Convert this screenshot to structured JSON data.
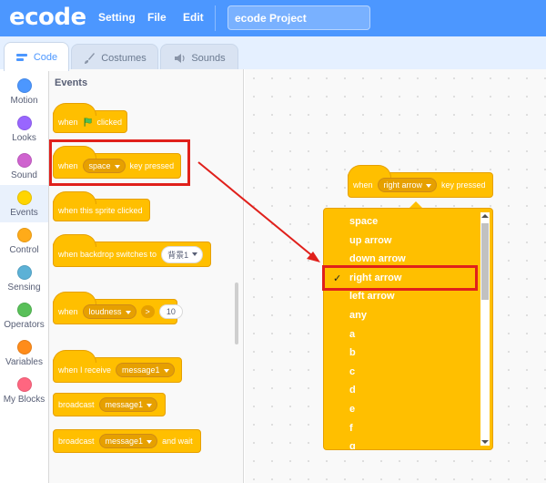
{
  "header": {
    "logo": "ecode",
    "menu": [
      "Setting",
      "File",
      "Edit"
    ],
    "project_title": "ecode Project"
  },
  "tabs": [
    "Code",
    "Costumes",
    "Sounds"
  ],
  "categories": [
    {
      "label": "Motion",
      "color": "#4c97ff"
    },
    {
      "label": "Looks",
      "color": "#9966ff"
    },
    {
      "label": "Sound",
      "color": "#cf63cf"
    },
    {
      "label": "Events",
      "color": "#ffd500"
    },
    {
      "label": "Control",
      "color": "#ffab19"
    },
    {
      "label": "Sensing",
      "color": "#5cb1d6"
    },
    {
      "label": "Operators",
      "color": "#59c059"
    },
    {
      "label": "Variables",
      "color": "#ff8c1a"
    },
    {
      "label": "My Blocks",
      "color": "#ff6680"
    }
  ],
  "palette": {
    "title": "Events",
    "flag_block": {
      "when": "when",
      "clicked": "clicked"
    },
    "key_block": {
      "when": "when",
      "key": "space",
      "pressed": "key pressed"
    },
    "sprite_clicked": "when this sprite clicked",
    "backdrop_block": {
      "text": "when backdrop switches to",
      "value": "背景1"
    },
    "loudness_block": {
      "when": "when",
      "sensor": "loudness",
      "op": ">",
      "value": "10"
    },
    "receive_block": {
      "text": "when I receive",
      "message": "message1"
    },
    "broadcast_block": {
      "text": "broadcast",
      "message": "message1"
    },
    "broadcast_wait_block": {
      "text": "broadcast",
      "message": "message1",
      "suffix": "and wait"
    }
  },
  "workspace": {
    "block": {
      "when": "when",
      "key": "right arrow",
      "pressed": "key pressed"
    },
    "dropdown": {
      "selected": "right arrow",
      "checkmark": "✓",
      "options": [
        "space",
        "up arrow",
        "down arrow",
        "right arrow",
        "left arrow",
        "any",
        "a",
        "b",
        "c",
        "d",
        "e",
        "f",
        "g"
      ]
    }
  },
  "colors": {
    "brand": "#4c97ff",
    "events": "#ffbf00",
    "highlight": "#e0201b"
  }
}
